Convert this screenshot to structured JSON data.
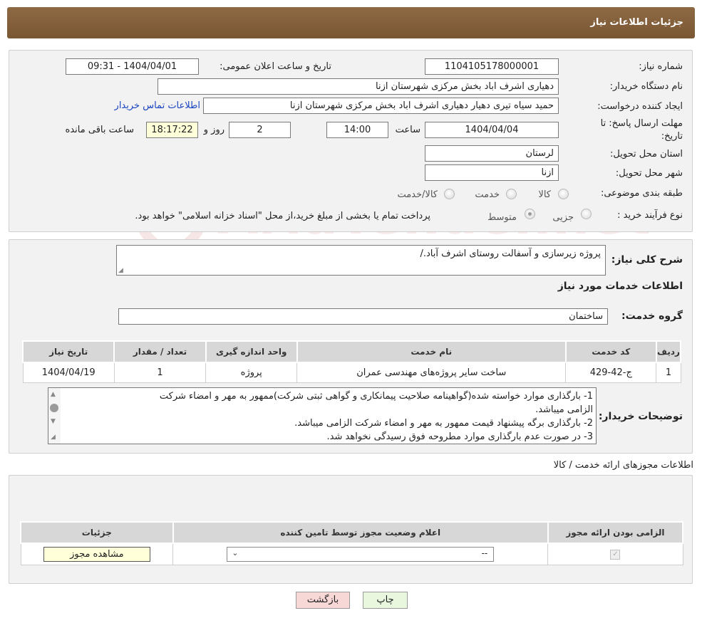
{
  "header": {
    "title": "جزئیات اطلاعات نیاز"
  },
  "watermark": "AriaTender.net",
  "details": {
    "need_number_label": "شماره نیاز:",
    "need_number": "1104105178000001",
    "announce_label": "تاریخ و ساعت اعلان عمومی:",
    "announce_value": "1404/04/01 - 09:31",
    "buyer_org_label": "نام دستگاه خریدار:",
    "buyer_org": "دهیاری اشرف اباد بخش مرکزی شهرستان ازنا",
    "requester_label": "ایجاد کننده درخواست:",
    "requester": "حمید سیاه تیری دهیار دهیاری اشرف اباد بخش مرکزی شهرستان ازنا",
    "buyer_contact_link": "اطلاعات تماس خریدار",
    "deadline_label": "مهلت ارسال پاسخ: تا تاریخ:",
    "deadline_date": "1404/04/04",
    "time_label": "ساعت",
    "deadline_time": "14:00",
    "days_value": "2",
    "days_label": "روز و",
    "remaining_time": "18:17:22",
    "remaining_label": "ساعت باقی مانده",
    "province_label": "استان محل تحویل:",
    "province": "لرستان",
    "city_label": "شهر محل تحویل:",
    "city": "ازنا",
    "category_label": "طبقه بندی موضوعی:",
    "category_options": [
      "کالا",
      "خدمت",
      "کالا/خدمت"
    ],
    "purchase_type_label": "نوع فرآیند خرید :",
    "purchase_options": [
      "جزیی",
      "متوسط"
    ],
    "purchase_note": "پرداخت تمام یا بخشی از مبلغ خرید،از محل \"اسناد خزانه اسلامی\" خواهد بود."
  },
  "summary": {
    "label": "شرح کلی نیاز:",
    "value": "پروژه زیرسازی و آسفالت روستای اشرف آباد./",
    "services_title": "اطلاعات خدمات مورد نیاز",
    "service_group_label": "گروه خدمت:",
    "service_group": "ساختمان"
  },
  "items_table": {
    "headers": [
      "ردیف",
      "کد خدمت",
      "نام خدمت",
      "واحد اندازه گیری",
      "تعداد / مقدار",
      "تاریخ نیاز"
    ],
    "rows": [
      [
        "1",
        "ج-42-429",
        "ساخت سایر پروژه‌های مهندسی عمران",
        "پروژه",
        "1",
        "1404/04/19"
      ]
    ]
  },
  "buyer_notes": {
    "label": "توضیحات خریدار:",
    "lines": [
      "1- بارگذاری موارد خواسته شده(گواهینامه صلاحیت پیمانکاری و گواهی ثبتی شرکت)ممهور به مهر و امضاء شرکت",
      "الزامی میباشد.",
      "2- بارگذاری برگه پیشنهاد قیمت ممهور به مهر و امضاء شرکت الزامی میباشد.",
      "3- در صورت عدم بارگذاری موارد مطروحه فوق رسیدگی نخواهد شد."
    ]
  },
  "permits": {
    "title": "اطلاعات مجوزهای ارائه خدمت / کالا",
    "headers": [
      "الزامی بودن ارائه مجوز",
      "اعلام وضعیت مجوز توسط تامین کننده",
      "جزئیات"
    ],
    "select_value": "--",
    "view_button": "مشاهده مجوز"
  },
  "buttons": {
    "print": "چاپ",
    "back": "بازگشت"
  }
}
